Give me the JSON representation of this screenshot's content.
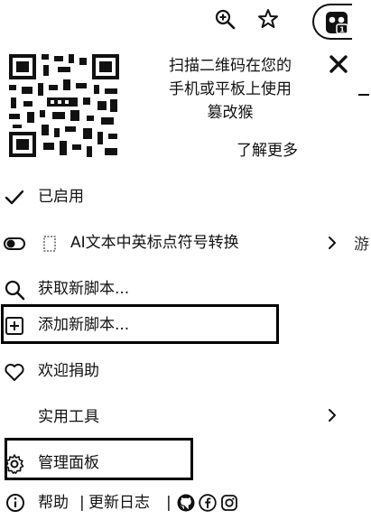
{
  "toolbar": {
    "zoom_icon": "magnifier-plus-icon",
    "star_icon": "star-icon",
    "extension_icon": "tampermonkey-icon"
  },
  "promo": {
    "line1": "扫描二维码在您的",
    "line2": "手机或平板上使用",
    "line3": "篡改猴",
    "learn_more": "了解更多",
    "close_icon": "close-icon"
  },
  "menu": {
    "enabled_label": "已启用",
    "script_label": "AI文本中英标点符号转换",
    "get_scripts_label": "获取新脚本...",
    "add_script_label": "添加新脚本...",
    "donate_label": "欢迎捐助",
    "utilities_label": "实用工具",
    "dashboard_label": "管理面板"
  },
  "footer": {
    "help": "帮助",
    "sep1": "|",
    "changelog": "更新日志",
    "sep2": "|"
  },
  "edge": {
    "cut_text": "游"
  },
  "colors": {
    "text": "#111111",
    "background": "#ffffff",
    "highlight_border": "#000000"
  }
}
